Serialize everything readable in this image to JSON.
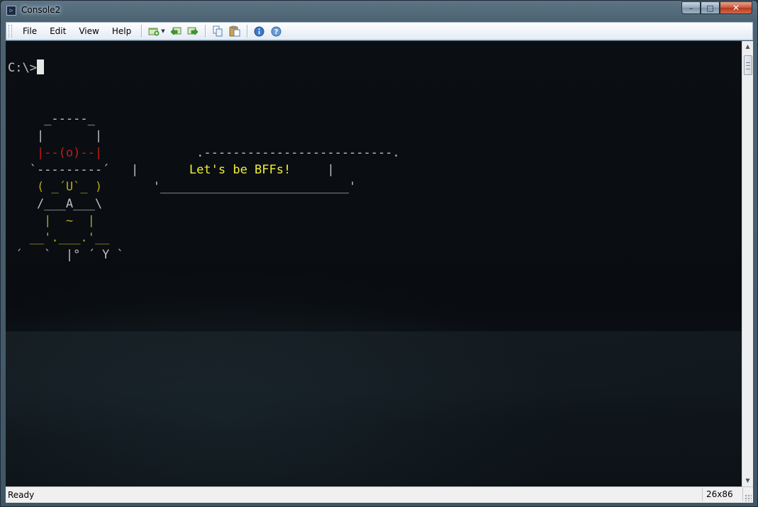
{
  "window": {
    "title": "Console2",
    "icon": "console-app-icon"
  },
  "window_controls": {
    "minimize": "–",
    "maximize": "□",
    "close": "✕"
  },
  "menu": {
    "file": "File",
    "edit": "Edit",
    "view": "View",
    "help": "Help"
  },
  "toolbar_icons": [
    "new-tab-icon",
    "prev-tab-icon",
    "next-tab-icon",
    "copy-icon",
    "paste-icon",
    "info-icon",
    "help-icon"
  ],
  "terminal": {
    "prompt": "C:\\>",
    "lines": [
      "",
      "",
      "     _-----_",
      "    |       |",
      "    |--(o)--|",
      "   `---------´",
      "    ( _´U`_ )",
      "    /___A___\\",
      "     |  ~  |",
      "   __'.___.'__",
      " ´   `  |° ´ Y `"
    ],
    "speech_bubble": {
      "top": ".--------------------------.",
      "message": "Let's be BFFs!",
      "bottom": "'__________________________'"
    }
  },
  "status": {
    "text": "Ready",
    "size": "26x86"
  },
  "colors": {
    "console_bg": "#07090c",
    "text": "#c0c0c0",
    "red": "#c01c1c",
    "yellow": "#b8a51a",
    "bright_yellow": "#f0f03a"
  }
}
